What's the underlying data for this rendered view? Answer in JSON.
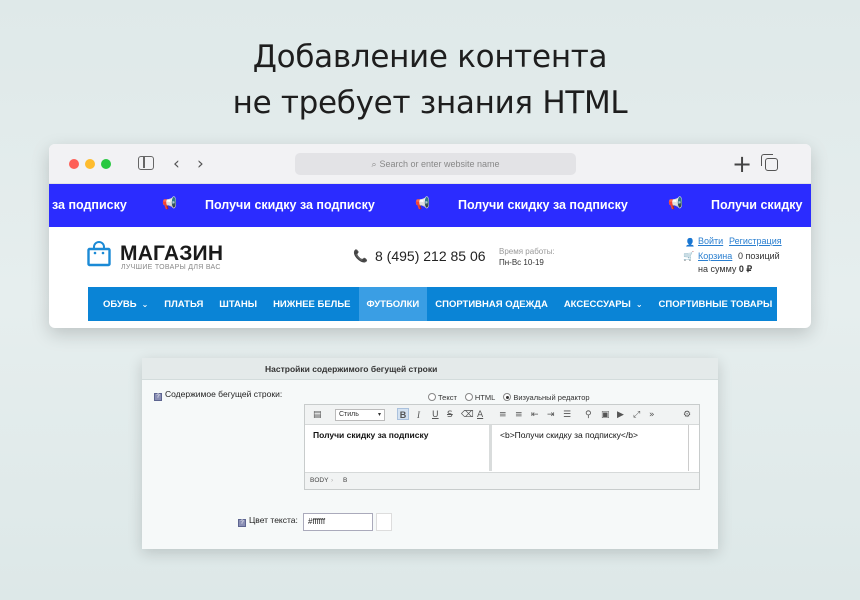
{
  "headline": {
    "line1": "Добавление контента",
    "line2": "не требует знания HTML"
  },
  "browser": {
    "address_placeholder": "Search or enter website name"
  },
  "marquee": {
    "items": [
      "за подписку",
      "Получи скидку за подписку",
      "Получи скидку за подписку",
      "Получи скидку"
    ],
    "icon": "megaphone-icon",
    "background": "#2b2cff"
  },
  "site": {
    "logo_title": "МАГАЗИН",
    "logo_subtitle": "ЛУЧШИЕ ТОВАРЫ ДЛЯ ВАС",
    "phone": "8 (495) 212 85 06",
    "hours_label": "Время работы:",
    "hours": "Пн-Вс 10-19",
    "login": "Войти",
    "register": "Регистрация",
    "cart": "Корзина",
    "cart_count": "0 позиций",
    "cart_sum_label": "на сумму",
    "cart_sum_value": "0 ₽"
  },
  "menu": {
    "items": [
      {
        "label": "ОБУВЬ",
        "has_dropdown": true
      },
      {
        "label": "ПЛАТЬЯ"
      },
      {
        "label": "ШТАНЫ"
      },
      {
        "label": "НИЖНЕЕ БЕЛЬЕ"
      },
      {
        "label": "ФУТБОЛКИ",
        "active": true
      },
      {
        "label": "СПОРТИВНАЯ ОДЕЖДА"
      },
      {
        "label": "АКСЕССУАРЫ",
        "has_dropdown": true
      },
      {
        "label": "СПОРТИВНЫЕ ТОВАРЫ"
      }
    ],
    "background": "#0a84d6"
  },
  "panel": {
    "title": "Настройки содержимого бегущей строки",
    "content_label": "Содержимое бегущей строки:",
    "radio_options": [
      "Текст",
      "HTML",
      "Визуальный редактор"
    ],
    "radio_selected": "Визуальный редактор",
    "style_select": "Стиль",
    "editor_text": "Получи скидку за подписку",
    "code_text": "<b>Получи скидку за подписку</b>",
    "status_tag1": "BODY",
    "status_tag2": "B",
    "color_label": "Цвет текста:",
    "color_value": "#ffffff"
  }
}
